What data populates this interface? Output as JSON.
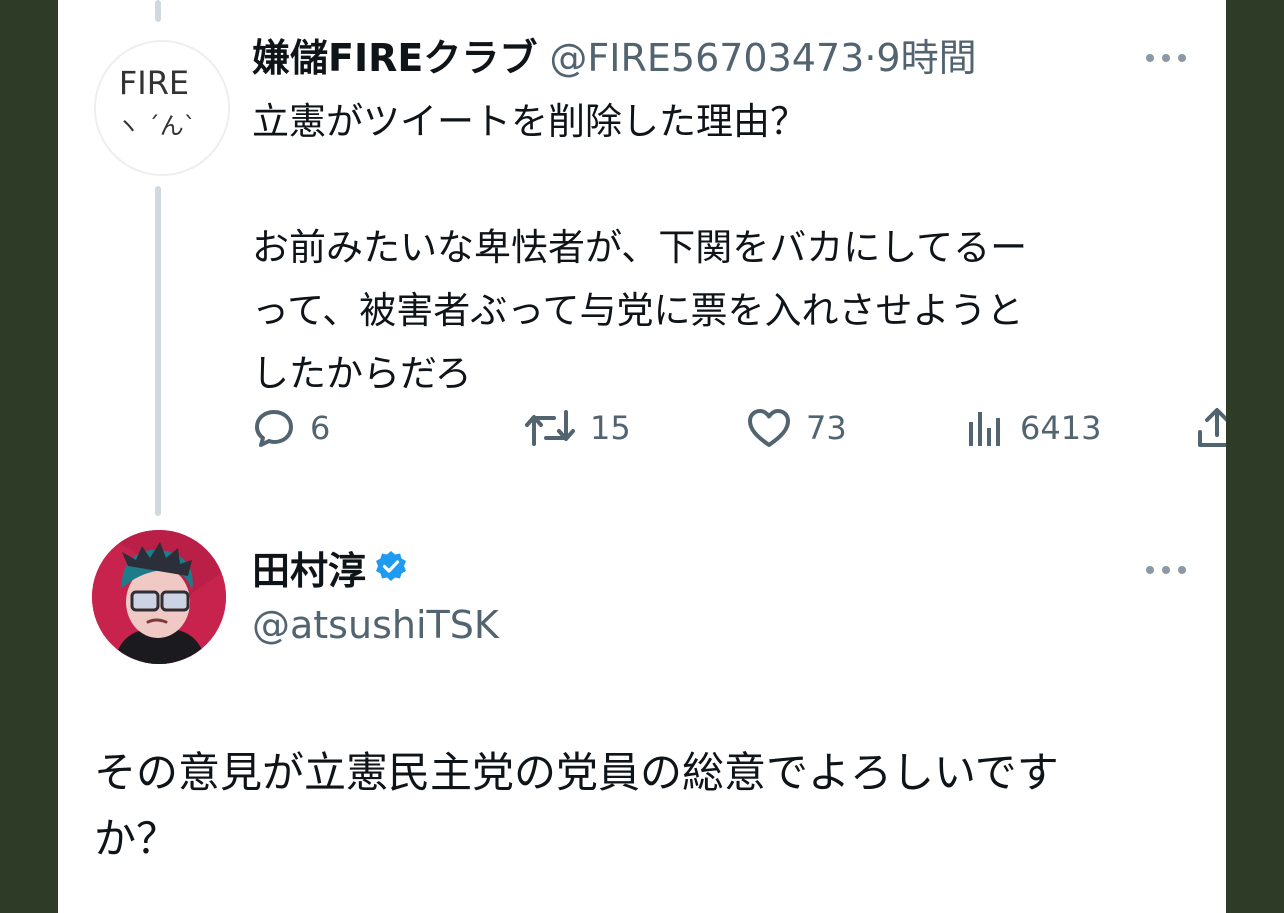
{
  "reply_tweet": {
    "display_name": "嫌儲FIREクラブ",
    "handle": "@FIRE56703473",
    "separator": "·",
    "time": "9時間",
    "avatar_text_top": "FIRE",
    "avatar_text_bottom": "ヽ ´ん`",
    "text_lines_1": [
      "立憲がツイートを削除した理由？"
    ],
    "text_lines_2": [
      "お前みたいな卑怯者が、下関をバカにしてるー",
      "って、被害者ぶって与党に票を入れさせようと",
      "したからだろ"
    ],
    "counts": {
      "replies": "6",
      "retweets": "15",
      "likes": "73",
      "views": "6413"
    }
  },
  "main_tweet": {
    "display_name": "田村淳",
    "handle": "@atsushiTSK",
    "verified": true,
    "text_lines": [
      "その意見が立憲民主党の党員の総意でよろしいです",
      "か？"
    ]
  },
  "colors": {
    "background": "#2d3b27",
    "card": "#ffffff",
    "secondary_text": "#536471",
    "verified_blue": "#1d9bf0",
    "avatar_pink": "#c8234d"
  },
  "icons": [
    "reply-icon",
    "retweet-icon",
    "like-icon",
    "views-icon",
    "share-icon",
    "more-icon",
    "verified-badge-icon"
  ]
}
